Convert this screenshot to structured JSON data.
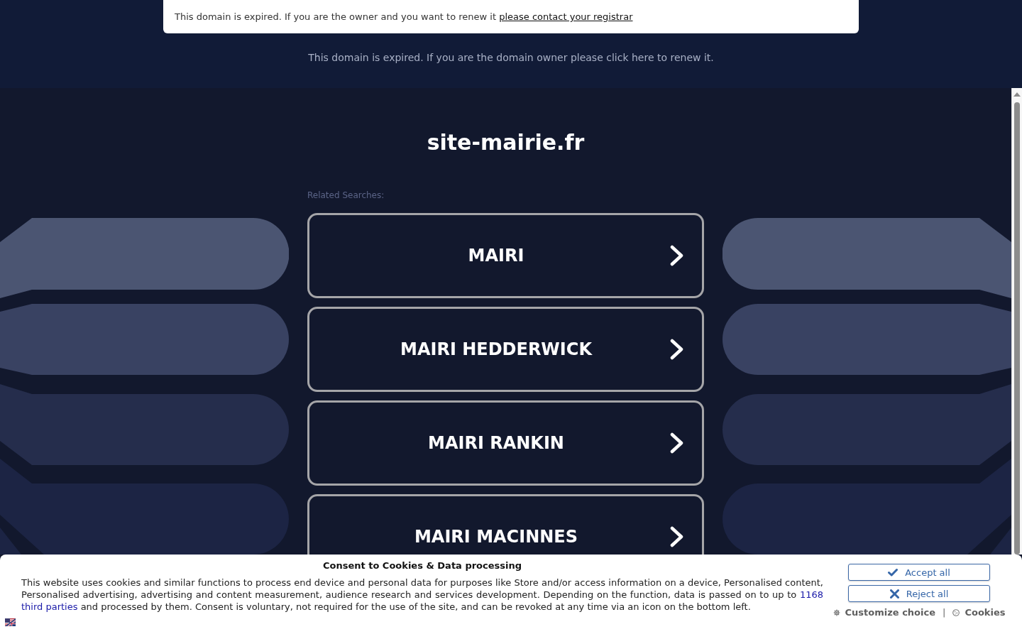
{
  "expiry_notice": {
    "text": "This domain is expired. If you are the owner and you want to renew it",
    "link": "please contact your registrar"
  },
  "renew_link": "This domain is expired. If you are the domain owner please click here to renew it.",
  "site_title": "site-mairie.fr",
  "related_searches": {
    "label": "Related Searches:",
    "items": [
      "MAIRI",
      "MAIRI HEDDERWICK",
      "MAIRI RANKIN",
      "MAIRI MACINNES"
    ]
  },
  "cookie_banner": {
    "title": "Consent to Cookies & Data processing",
    "body": [
      {
        "kind": "text",
        "text": "This website uses cookies and similar functions to process end device and personal data for purposes like Store and/or access information on a device, Personalised content, Personalised advertising, advertising and content measurement, audience research and services development. Depending on the function, data is passed on to up to"
      },
      {
        "kind": "link",
        "text": "1168"
      },
      {
        "kind": "link",
        "text": "third parties"
      },
      {
        "kind": "text",
        "text": "and processed by them. Consent is voluntary, not required for the use of the site, and can be revoked at any time via an icon on the bottom left."
      }
    ],
    "buttons": [
      {
        "kind": "accept",
        "label": "Accept all"
      },
      {
        "kind": "reject",
        "label": "Reject all"
      }
    ],
    "links": [
      {
        "kind": "customize",
        "label": "Customize choice"
      },
      {
        "kind": "cookies",
        "label": "Cookies"
      }
    ],
    "separator": "|"
  }
}
